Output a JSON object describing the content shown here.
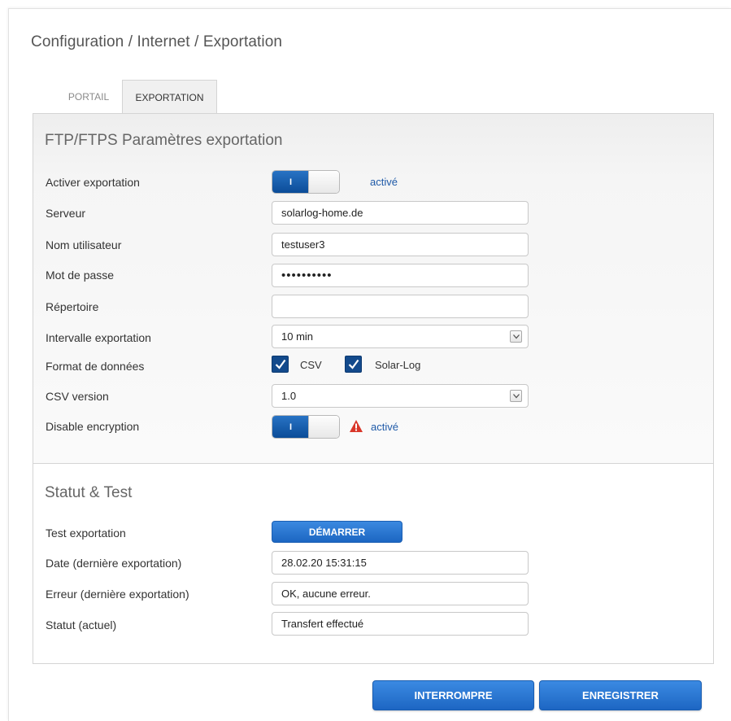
{
  "breadcrumb": "Configuration / Internet / Exportation",
  "tabs": [
    {
      "label": "PORTAIL",
      "active": false
    },
    {
      "label": "EXPORTATION",
      "active": true
    }
  ],
  "ftp_section": {
    "title": "FTP/FTPS Paramètres exportation",
    "enable_export": {
      "label": "Activer exportation",
      "toggle_text": "I",
      "status": "activé"
    },
    "server": {
      "label": "Serveur",
      "value": "solarlog-home.de"
    },
    "username": {
      "label": "Nom utilisateur",
      "value": "testuser3"
    },
    "password": {
      "label": "Mot de passe",
      "value": "••••••••••"
    },
    "directory": {
      "label": "Répertoire",
      "value": ""
    },
    "interval": {
      "label": "Intervalle exportation",
      "value": "10 min"
    },
    "data_format": {
      "label": "Format de données",
      "option1": "CSV",
      "option2": "Solar-Log"
    },
    "csv_version": {
      "label": "CSV version",
      "value": "1.0"
    },
    "disable_encryption": {
      "label": "Disable encryption",
      "toggle_text": "I",
      "status": "activé"
    }
  },
  "status_section": {
    "title": "Statut & Test",
    "test": {
      "label": "Test exportation",
      "button": "DÉMARRER"
    },
    "date": {
      "label": "Date (dernière exportation)",
      "value": "28.02.20 15:31:15"
    },
    "error": {
      "label": "Erreur (dernière exportation)",
      "value": "OK, aucune erreur."
    },
    "status": {
      "label": "Statut (actuel)",
      "value": "Transfert effectué"
    }
  },
  "footer": {
    "cancel_label": "INTERROMPRE",
    "save_label": "ENREGISTRER"
  },
  "colors": {
    "accent": "#1c66c2",
    "toggle_on": "#0b4c98",
    "status_text": "#1f5aa8",
    "warning": "#d9372a"
  }
}
